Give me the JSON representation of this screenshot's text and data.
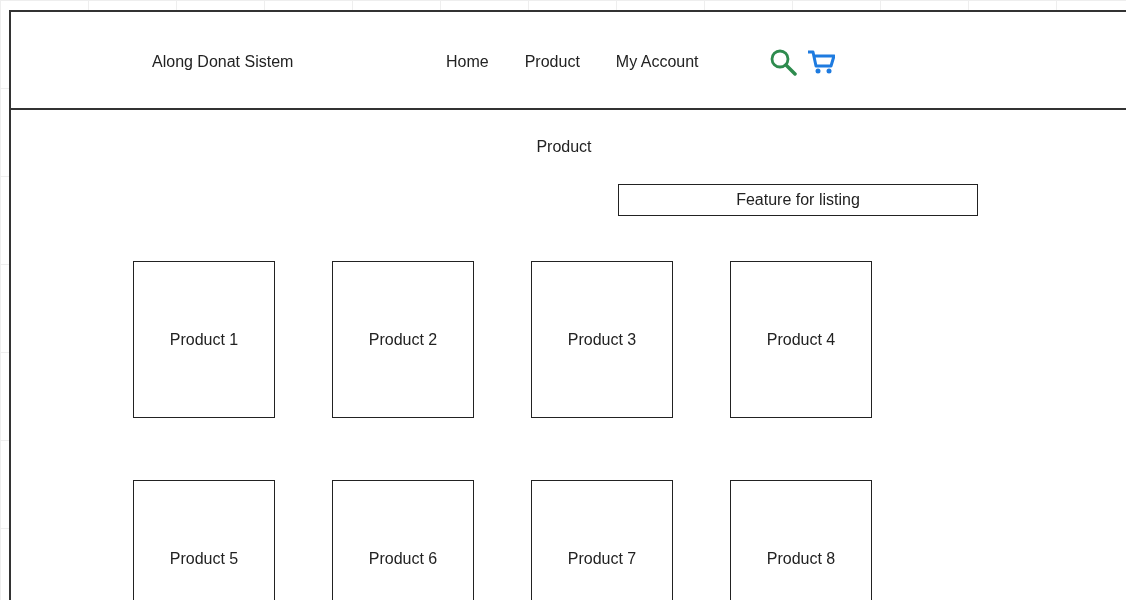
{
  "header": {
    "title": "Along Donat Sistem",
    "nav": [
      {
        "label": "Home"
      },
      {
        "label": "Product"
      },
      {
        "label": "My Account"
      }
    ]
  },
  "page_title": "Product",
  "feature_box": "Feature for listing",
  "products": [
    {
      "label": "Product 1"
    },
    {
      "label": "Product 2"
    },
    {
      "label": "Product 3"
    },
    {
      "label": "Product 4"
    },
    {
      "label": "Product 5"
    },
    {
      "label": "Product 6"
    },
    {
      "label": "Product 7"
    },
    {
      "label": "Product 8"
    }
  ]
}
